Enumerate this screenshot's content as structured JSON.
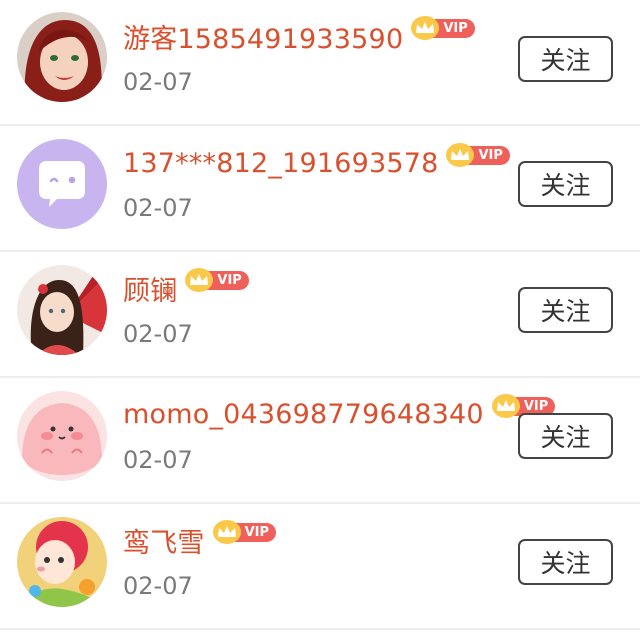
{
  "followers": [
    {
      "name": "游客1585491933590",
      "vip": "VIP",
      "date": "02-07",
      "action": "关注",
      "avatar_icon": "cartoon-woman-avatar"
    },
    {
      "name": "137***812_191693578",
      "vip": "VIP",
      "date": "02-07",
      "action": "关注",
      "avatar_icon": "chat-bubble-avatar"
    },
    {
      "name": "顾镧",
      "vip": "VIP",
      "date": "02-07",
      "action": "关注",
      "avatar_icon": "fan-girl-avatar"
    },
    {
      "name": "momo_043698779648340",
      "vip": "VIP",
      "date": "02-07",
      "action": "关注",
      "avatar_icon": "pink-blob-avatar"
    },
    {
      "name": "鸾飞雪",
      "vip": "VIP",
      "date": "02-07",
      "action": "关注",
      "avatar_icon": "cartoon-kid-avatar"
    }
  ],
  "colors": {
    "name": "#d9502e",
    "vip_badge": "#f0605a",
    "crown": "#fbc94a",
    "date": "#7a7a7a"
  }
}
